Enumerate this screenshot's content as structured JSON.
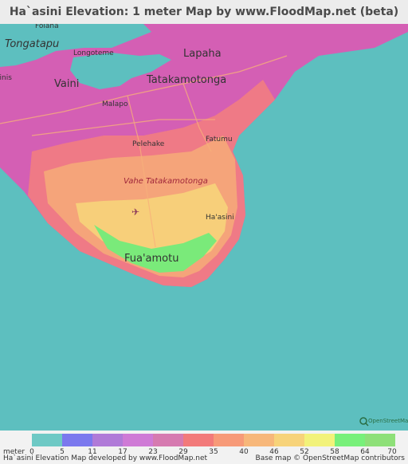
{
  "title": "Ha`asini Elevation: 1 meter Map by www.FloodMap.net (beta)",
  "places": {
    "folaha": "Folaha",
    "tongatapu": "Tongatapu",
    "longoteme": "Longoteme",
    "lapaha": "Lapaha",
    "vaini": "Vaini",
    "tatakamotonga": "Tatakamotonga",
    "ainis": "ainis",
    "malapo": "Malapo",
    "fatumu": "Fatumu",
    "pelehake": "Pelehake",
    "vahe": "Vahe Tatakamotonga",
    "haasini": "Ha'asini",
    "fuaamotu": "Fua'amotu"
  },
  "osm_logo_text": "OpenStreetMap",
  "legend": {
    "unit": "meter",
    "ticks": [
      "0",
      "5",
      "11",
      "17",
      "23",
      "29",
      "35",
      "40",
      "46",
      "52",
      "58",
      "64",
      "70"
    ],
    "colors": [
      "#6ec9c5",
      "#7b78ee",
      "#b07ad8",
      "#cf7ad6",
      "#d67ab0",
      "#f27a7a",
      "#f79a78",
      "#f7b77a",
      "#f7d37a",
      "#f2f27a",
      "#78f07a",
      "#8ee078"
    ]
  },
  "footer": {
    "left": "Ha`asini Elevation Map developed by www.FloodMap.net",
    "right": "Base map © OpenStreetMap contributors"
  },
  "colors": {
    "sea": "#5dbfbf",
    "land_low": "#d863b8",
    "land_mid": "#f07a82",
    "land_high": "#f7c07a",
    "land_top": "#7aea7a"
  }
}
